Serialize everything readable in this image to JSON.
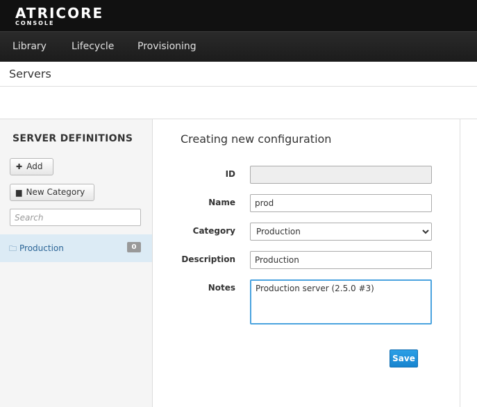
{
  "brand": {
    "name": "ATRICORE",
    "subtitle": "CONSOLE",
    "color": "#111111"
  },
  "nav": {
    "items": [
      {
        "label": "Library"
      },
      {
        "label": "Lifecycle"
      },
      {
        "label": "Provisioning"
      }
    ]
  },
  "page": {
    "title": "Servers"
  },
  "sidebar": {
    "heading": "SERVER DEFINITIONS",
    "add_button": {
      "label": "Add",
      "icon": "plus-icon"
    },
    "new_category_button": {
      "label": "New Category",
      "icon": "folder-icon"
    },
    "search": {
      "placeholder": "Search",
      "value": ""
    },
    "tree": [
      {
        "label": "Production",
        "icon": "folder-open-icon",
        "count": "0",
        "selected": true
      }
    ],
    "selected_bg": "#dcebf5"
  },
  "form": {
    "title": "Creating new configuration",
    "fields": {
      "id": {
        "label": "ID",
        "value": ""
      },
      "name": {
        "label": "Name",
        "value": "prod"
      },
      "category": {
        "label": "Category",
        "value": "Production",
        "options": [
          "Production"
        ]
      },
      "description": {
        "label": "Description",
        "value": "Production"
      },
      "notes": {
        "label": "Notes",
        "value": "Production server (2.5.0 #3)"
      }
    },
    "save_label": "Save",
    "accent": "#1784cf"
  }
}
